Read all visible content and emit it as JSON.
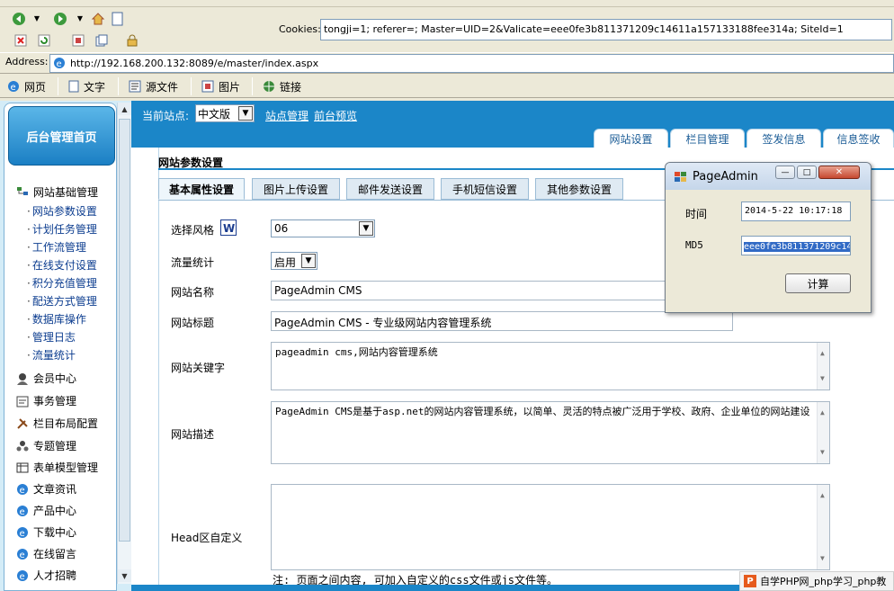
{
  "browser": {
    "cookies_label": "Cookies:",
    "cookies_value": "tongji=1; referer=; Master=UID=2&Valicate=eee0fe3b811371209c14611a157133188fee314a; SiteId=1",
    "address_label": "Address:",
    "address_value": "http://192.168.200.132:8089/e/master/index.aspx",
    "view_buttons": [
      "网页",
      "文字",
      "源文件",
      "图片",
      "链接"
    ]
  },
  "sidebar": {
    "home_label": "后台管理首页",
    "sections": [
      {
        "label": "网站基础管理",
        "icon": "tree-icon"
      },
      {
        "label": "会员中心",
        "icon": "member-icon"
      },
      {
        "label": "事务管理",
        "icon": "task-icon"
      },
      {
        "label": "栏目布局配置",
        "icon": "layout-icon"
      },
      {
        "label": "专题管理",
        "icon": "topic-icon"
      },
      {
        "label": "表单模型管理",
        "icon": "form-icon"
      },
      {
        "label": "文章资讯",
        "icon": "ie-icon"
      },
      {
        "label": "产品中心",
        "icon": "ie-icon"
      },
      {
        "label": "下载中心",
        "icon": "ie-icon"
      },
      {
        "label": "在线留言",
        "icon": "ie-icon"
      },
      {
        "label": "人才招聘",
        "icon": "ie-icon"
      }
    ],
    "sub_items": [
      "网站参数设置",
      "计划任务管理",
      "工作流管理",
      "在线支付设置",
      "积分充值管理",
      "配送方式管理",
      "数据库操作",
      "管理日志",
      "流量统计"
    ]
  },
  "header": {
    "current_site_label": "当前站点:",
    "current_site_value": "中文版",
    "link_site_manage": "站点管理",
    "link_preview": "前台预览",
    "tabs": [
      "网站设置",
      "栏目管理",
      "签发信息",
      "信息签收"
    ]
  },
  "main": {
    "section_title": "网站参数设置",
    "subtabs": [
      "基本属性设置",
      "图片上传设置",
      "邮件发送设置",
      "手机短信设置",
      "其他参数设置"
    ],
    "fields": {
      "style_label": "选择风格",
      "style_value": "06",
      "stats_label": "流量统计",
      "stats_value": "启用",
      "name_label": "网站名称",
      "name_value": "PageAdmin CMS",
      "title_label": "网站标题",
      "title_value": "PageAdmin CMS - 专业级网站内容管理系统",
      "keywords_label": "网站关键字",
      "keywords_value": "pageadmin cms,网站内容管理系统",
      "desc_label": "网站描述",
      "desc_value": "PageAdmin CMS是基于asp.net的网站内容管理系统，以简单、灵活的特点被广泛用于学校、政府、企业单位的网站建设",
      "head_label": "Head区自定义",
      "head_value": "",
      "hint": "注: 页面之间内容, 可加入自定义的css文件或js文件等。"
    }
  },
  "dialog": {
    "title": "PageAdmin",
    "time_label": "时间",
    "time_value": "2014-5-22 10:17:18",
    "md5_label": "MD5",
    "md5_value": "eee0fe3b811371209c14",
    "calc_button": "计算"
  },
  "watermark": {
    "text": "自学PHP网_php学习_php教"
  },
  "colors": {
    "header_blue": "#1b86c8",
    "sidebar_bg": "#d4ecf7",
    "selection": "#316ac5"
  }
}
